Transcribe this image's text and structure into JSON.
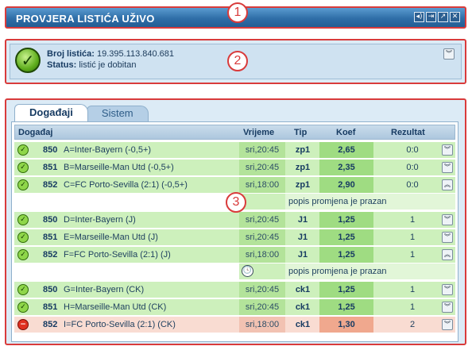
{
  "window": {
    "title": "PROVJERA LISTIĆA UŽIVO",
    "buttons": [
      {
        "name": "sound-icon",
        "glyph": "◂)"
      },
      {
        "name": "pin-icon",
        "glyph": "⇥"
      },
      {
        "name": "popout-icon",
        "glyph": "↗"
      },
      {
        "name": "close-icon",
        "glyph": "✕"
      }
    ]
  },
  "markers": [
    "1",
    "2",
    "3"
  ],
  "ticket": {
    "number_label": "Broj listića:",
    "number": "19.395.113.840.681",
    "status_label": "Status:",
    "status": "listić je dobitan"
  },
  "tabs": [
    {
      "label": "Događaji",
      "active": true
    },
    {
      "label": "Sistem",
      "active": false
    }
  ],
  "columns": {
    "event": "Događaj",
    "time": "Vrijeme",
    "tip": "Tip",
    "koef": "Koef",
    "result": "Rezultat"
  },
  "rows": [
    {
      "code": "850",
      "desc": "A=Inter-Bayern (-0,5+)",
      "time": "sri,20:45",
      "tip": "zp1",
      "koef": "2,65",
      "result": "0:0",
      "state": "ok",
      "expanded": false
    },
    {
      "code": "851",
      "desc": "B=Marseille-Man Utd (-0,5+)",
      "time": "sri,20:45",
      "tip": "zp1",
      "koef": "2,35",
      "result": "0:0",
      "state": "ok",
      "expanded": false
    },
    {
      "code": "852",
      "desc": "C=FC Porto-Sevilla (2:1) (-0,5+)",
      "time": "sri,18:00",
      "tip": "zp1",
      "koef": "2,90",
      "result": "0:0",
      "state": "ok",
      "expanded": true
    },
    {
      "code": "850",
      "desc": "D=Inter-Bayern (J)",
      "time": "sri,20:45",
      "tip": "J1",
      "koef": "1,25",
      "result": "1",
      "state": "ok",
      "expanded": false
    },
    {
      "code": "851",
      "desc": "E=Marseille-Man Utd (J)",
      "time": "sri,20:45",
      "tip": "J1",
      "koef": "1,25",
      "result": "1",
      "state": "ok",
      "expanded": false
    },
    {
      "code": "852",
      "desc": "F=FC Porto-Sevilla (2:1) (J)",
      "time": "sri,18:00",
      "tip": "J1",
      "koef": "1,25",
      "result": "1",
      "state": "ok",
      "expanded": true
    },
    {
      "code": "850",
      "desc": "G=Inter-Bayern (CK)",
      "time": "sri,20:45",
      "tip": "ck1",
      "koef": "1,25",
      "result": "1",
      "state": "ok",
      "expanded": false
    },
    {
      "code": "851",
      "desc": "H=Marseille-Man Utd (CK)",
      "time": "sri,20:45",
      "tip": "ck1",
      "koef": "1,25",
      "result": "1",
      "state": "ok",
      "expanded": false
    },
    {
      "code": "852",
      "desc": "I=FC Porto-Sevilla (2:1) (CK)",
      "time": "sri,18:00",
      "tip": "ck1",
      "koef": "1,30",
      "result": "2",
      "state": "lost",
      "expanded": false
    }
  ],
  "subrows": [
    {
      "text": "popis promjena je prazan",
      "icon": "none"
    },
    {
      "text": "popis promjena je prazan",
      "icon": "clock-icon"
    }
  ]
}
